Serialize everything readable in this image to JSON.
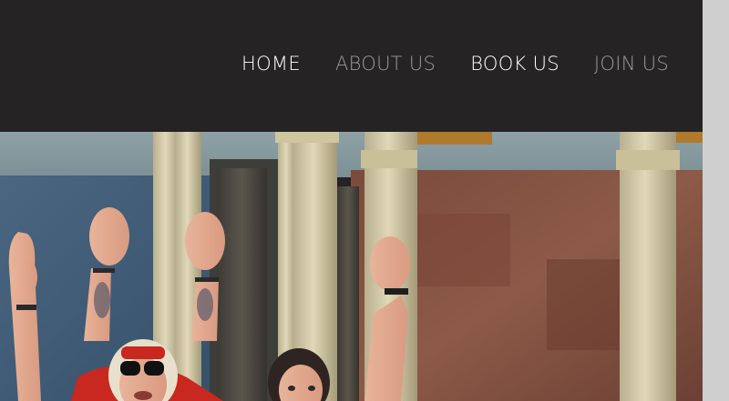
{
  "nav": {
    "items": [
      {
        "label": "HOME",
        "state": "active"
      },
      {
        "label": "ABOUT US",
        "state": "muted"
      },
      {
        "label": "BOOK US",
        "state": "active"
      },
      {
        "label": "JOIN US",
        "state": "muted"
      }
    ]
  },
  "colors": {
    "header_bg": "#252324",
    "nav_active": "#ffffff",
    "nav_muted": "#9a9a9a",
    "scrollbar": "#cfcfcf"
  },
  "hero": {
    "image_subject": "group photo of people waving raised hands in front of stone columns"
  }
}
